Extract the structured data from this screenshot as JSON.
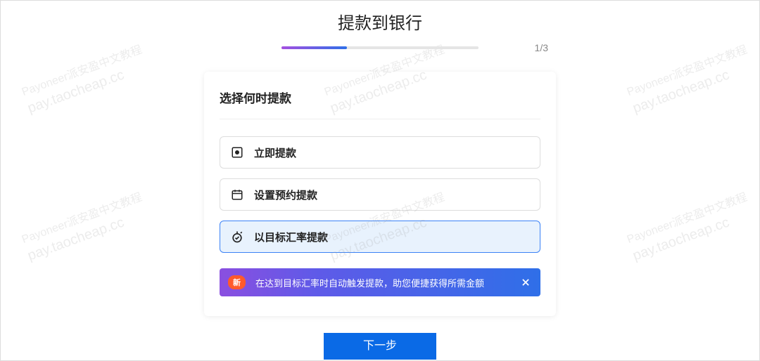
{
  "page": {
    "title": "提款到银行",
    "step_indicator": "1/3"
  },
  "card": {
    "title": "选择何时提款",
    "options": [
      {
        "label": "立即提款"
      },
      {
        "label": "设置预约提款"
      },
      {
        "label": "以目标汇率提款"
      }
    ]
  },
  "banner": {
    "badge": "新",
    "text": "在达到目标汇率时自动触发提款，助您便捷获得所需金额"
  },
  "buttons": {
    "next": "下一步"
  },
  "watermark": {
    "line1": "Payoneer派安盈中文教程",
    "line2": "pay.taocheap.cc"
  }
}
